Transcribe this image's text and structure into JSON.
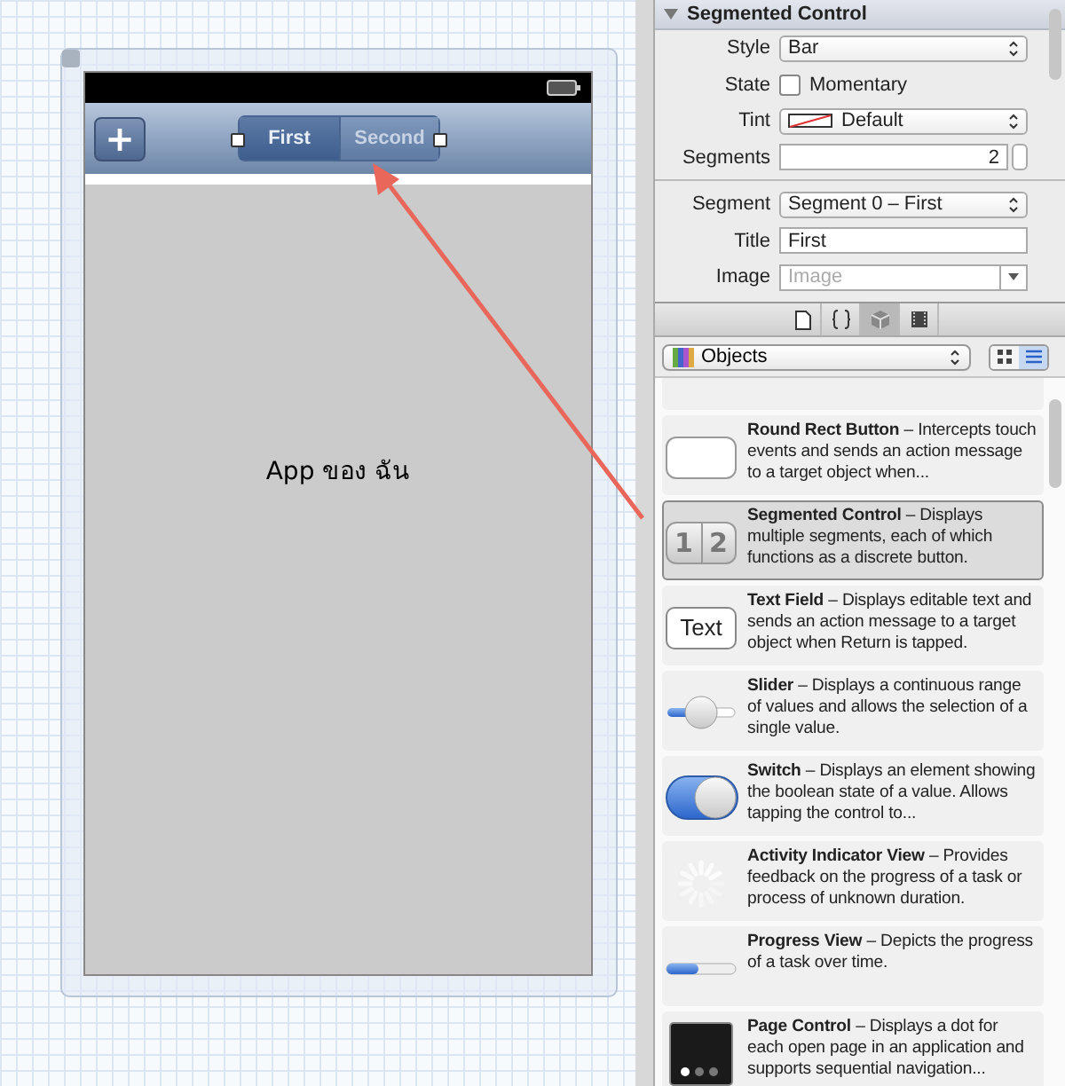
{
  "canvas": {
    "device": {
      "nav_bar": {
        "add_button": "+",
        "segments": [
          {
            "label": "First",
            "selected": true
          },
          {
            "label": "Second",
            "selected": false
          }
        ]
      },
      "view_label": "App ของ ฉัน"
    }
  },
  "inspector": {
    "section": {
      "title": "Segmented Control",
      "expanded": true
    },
    "fields": [
      {
        "kind": "select",
        "label": "Style",
        "value": "Bar"
      },
      {
        "kind": "checkbox",
        "label": "State",
        "text": "Momentary",
        "checked": false
      },
      {
        "kind": "tint",
        "label": "Tint",
        "value": "Default"
      },
      {
        "kind": "stepper",
        "label": "Segments",
        "value": "2"
      },
      {
        "kind": "divider"
      },
      {
        "kind": "select",
        "label": "Segment",
        "value": "Segment 0 – First"
      },
      {
        "kind": "text",
        "label": "Title",
        "value": "First"
      },
      {
        "kind": "combo",
        "label": "Image",
        "placeholder": "Image"
      }
    ]
  },
  "library": {
    "tabs": [
      {
        "kind": "file",
        "selected": false
      },
      {
        "kind": "braces",
        "selected": false
      },
      {
        "kind": "cube",
        "selected": true
      },
      {
        "kind": "film",
        "selected": false
      }
    ],
    "filter": {
      "value": "Objects"
    },
    "views": [
      {
        "kind": "grid",
        "selected": false
      },
      {
        "kind": "list",
        "selected": true
      }
    ],
    "items": [
      {
        "kind": "roundrect",
        "name": "Round Rect Button",
        "description": "– Intercepts touch events and sends an action message to a target object when...",
        "selected": false
      },
      {
        "kind": "segmented",
        "name": "Segmented Control",
        "description": "– Displays multiple segments, each of which functions as a discrete button.",
        "selected": true,
        "icon_text": [
          "1",
          "2"
        ]
      },
      {
        "kind": "textfield",
        "name": "Text Field",
        "description": "– Displays editable text and sends an action message to a target object when Return is tapped.",
        "selected": false,
        "icon_text": [
          "Text"
        ]
      },
      {
        "kind": "slider",
        "name": "Slider",
        "description": "– Displays a continuous range of values and allows the selection of a single value.",
        "selected": false
      },
      {
        "kind": "switch",
        "name": "Switch",
        "description": "– Displays an element showing the boolean state of a value. Allows tapping the control to...",
        "selected": false
      },
      {
        "kind": "activity",
        "name": "Activity Indicator View",
        "description": "– Provides feedback on the progress of a task or process of unknown duration.",
        "selected": false
      },
      {
        "kind": "progress",
        "name": "Progress View",
        "description": "– Depicts the progress of a task over time.",
        "selected": false
      },
      {
        "kind": "pagecontrol",
        "name": "Page Control",
        "description": "– Displays a dot for each open page in an application and supports sequential navigation...",
        "selected": false
      }
    ]
  }
}
